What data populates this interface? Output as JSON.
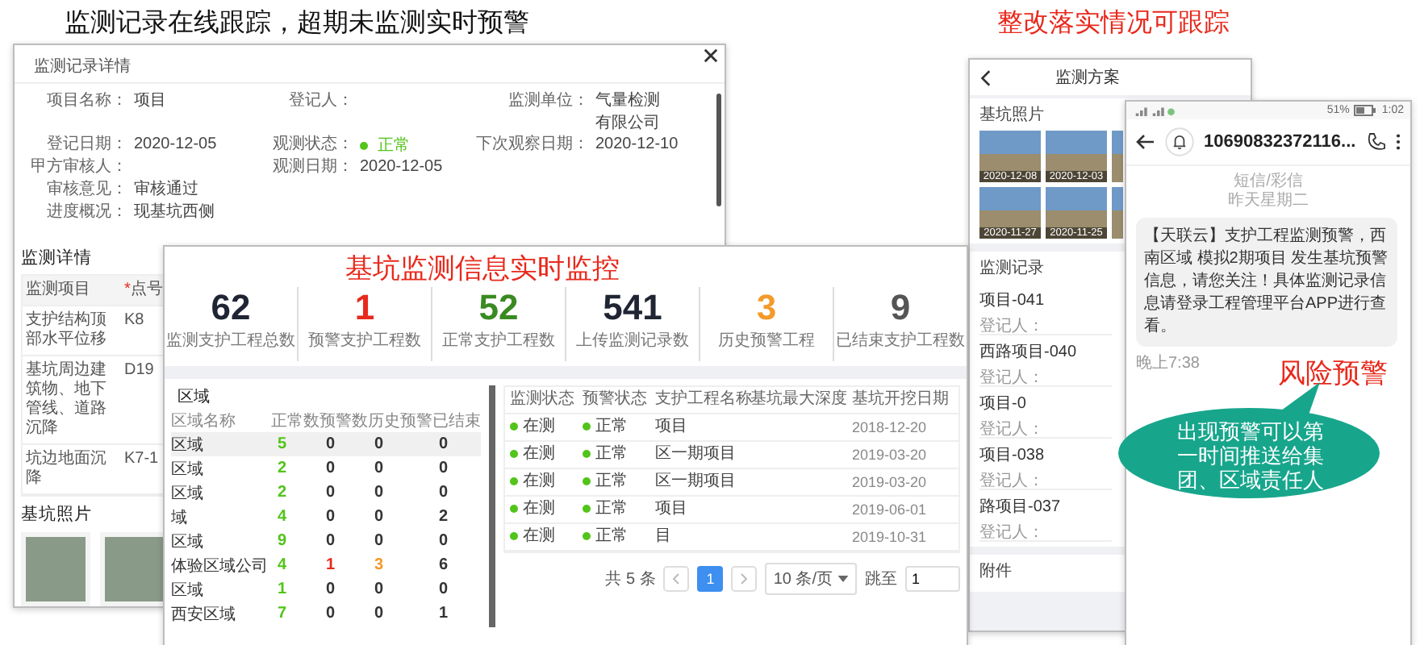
{
  "headline_left": "监测记录在线跟踪，超期未监测实时预警",
  "headline_right": "整改落实情况可跟踪",
  "detail_window": {
    "title": "监测记录详情",
    "field_rows": [
      [
        {
          "label": "项目名称：",
          "value": "项目"
        },
        {
          "label": "登记人："
        },
        {
          "label": "监测单位：",
          "value": "气量检测",
          "value_line2": "有限公司"
        }
      ],
      [
        {
          "label": "登记日期：",
          "value": "2020-12-05"
        },
        {
          "label": "观测状态：",
          "value": "正常",
          "kind": "status"
        },
        {
          "label": "下次观察日期：",
          "value": "2020-12-10"
        }
      ],
      [
        {
          "label": "甲方审核人："
        },
        {
          "label": "观测日期：",
          "value": "2020-12-05"
        }
      ],
      [
        {
          "label": "审核意见：",
          "value": "审核通过"
        }
      ],
      [
        {
          "label": "进度概况：",
          "value": "现基坑西侧"
        }
      ]
    ],
    "detail_heading": "监测详情",
    "detail_columns": [
      {
        "label": "监测项目"
      },
      {
        "label": "点号",
        "mark": "*"
      }
    ],
    "detail_rows": [
      [
        "支护结构顶部水平位移",
        "K8"
      ],
      [
        "基坑周边建筑物、地下管线、道路沉降",
        "D19"
      ],
      [
        "坑边地面沉降",
        "K7-1"
      ]
    ],
    "photos_heading": "基坑照片",
    "photos": [
      {
        "kind": "photo"
      },
      {
        "kind": "photo"
      }
    ]
  },
  "dashboard": {
    "banner": "基坑监测信息实时监控",
    "stats": [
      {
        "value": "62",
        "label": "监测支护工程总数",
        "color": "#1f2533"
      },
      {
        "value": "1",
        "label": "预警支护工程数",
        "color": "#e8291c"
      },
      {
        "value": "52",
        "label": "正常支护工程数",
        "color": "#3a8a22"
      },
      {
        "value": "541",
        "label": "上传监测记录数",
        "color": "#1f2533"
      },
      {
        "value": "3",
        "label": "历史预警工程",
        "color": "#f39a2b"
      },
      {
        "value": "9",
        "label": "已结束支护工程数",
        "color": "#555555"
      }
    ],
    "area_panel": {
      "title": "区域",
      "columns": [
        "区域名称",
        "正常数",
        "预警数",
        "历史预警",
        "已结束"
      ],
      "rows": [
        {
          "name": "区域",
          "normal": "5",
          "warning": "0",
          "history": "0",
          "closed": "0",
          "selected": true
        },
        {
          "name": "区域",
          "normal": "2",
          "warning": "0",
          "history": "0",
          "closed": "0",
          "selected": false
        },
        {
          "name": "区域",
          "normal": "2",
          "warning": "0",
          "history": "0",
          "closed": "0",
          "selected": false
        },
        {
          "name": "域",
          "normal": "4",
          "warning": "0",
          "history": "0",
          "closed": "2",
          "selected": false
        },
        {
          "name": "区域",
          "normal": "9",
          "warning": "0",
          "history": "0",
          "closed": "0",
          "selected": false
        },
        {
          "name": "体验区域公司",
          "normal": "4",
          "warning": "1",
          "history": "3",
          "closed": "6",
          "selected": false
        },
        {
          "name": "区域",
          "normal": "1",
          "warning": "0",
          "history": "0",
          "closed": "0",
          "selected": false
        },
        {
          "name": "西安区域",
          "normal": "7",
          "warning": "0",
          "history": "0",
          "closed": "1",
          "selected": false
        }
      ]
    },
    "project_columns": [
      "监测状态",
      "预警状态",
      "支护工程名称",
      "基坑最大深度",
      "基坑开挖日期"
    ],
    "project_rows": [
      {
        "monitor": "在测",
        "warning": "正常",
        "name": "项目",
        "date": "2018-12-20"
      },
      {
        "monitor": "在测",
        "warning": "正常",
        "name": "区一期项目",
        "date": "2019-03-20"
      },
      {
        "monitor": "在测",
        "warning": "正常",
        "name": "区一期项目",
        "date": "2019-03-20"
      },
      {
        "monitor": "在测",
        "warning": "正常",
        "name": "项目",
        "date": "2019-06-01"
      },
      {
        "monitor": "在测",
        "warning": "正常",
        "name": "目",
        "date": "2019-10-31"
      }
    ],
    "pagination": {
      "total": "共 5 条",
      "pages": [
        {
          "label": "1",
          "selected": true
        }
      ],
      "page_size": "10 条/页",
      "jump_label": "跳至",
      "jump_value": "1"
    }
  },
  "phone_app": {
    "title": "监测方案",
    "photos_heading": "基坑照片",
    "photos": [
      {
        "kind": "photo",
        "date": "2020-12-08"
      },
      {
        "kind": "photo",
        "date": "2020-12-03"
      },
      {
        "kind": "photo"
      },
      {
        "kind": "photo",
        "date": "2020-11-27"
      },
      {
        "kind": "photo",
        "date": "2020-11-25"
      },
      {
        "kind": "photo"
      }
    ],
    "records_heading": "监测记录",
    "records": [
      {
        "title": "项目-041",
        "registrant": "登记人："
      },
      {
        "title": "西路项目-040",
        "registrant": "登记人："
      },
      {
        "title": "项目-0",
        "registrant": "登记人："
      },
      {
        "title": "项目-038",
        "registrant": "登记人："
      },
      {
        "title": "路项目-037",
        "registrant": "登记人："
      }
    ],
    "attachments_heading": "附件"
  },
  "sms": {
    "battery": "51%",
    "time": "1:02",
    "sender": "10690832372116...",
    "channel": "短信/彩信",
    "day": "昨天星期二",
    "message": "【天联云】支护工程监测预警，西南区域 模拟2期项目 发生基坑预警信息，请您关注！具体监测记录信息请登录工程管理平台APP进行查看。",
    "sent": "晚上7:38"
  },
  "alert_label": "风险预警",
  "callout": "出现预警可以第一时间推送给集团、区域责任人"
}
